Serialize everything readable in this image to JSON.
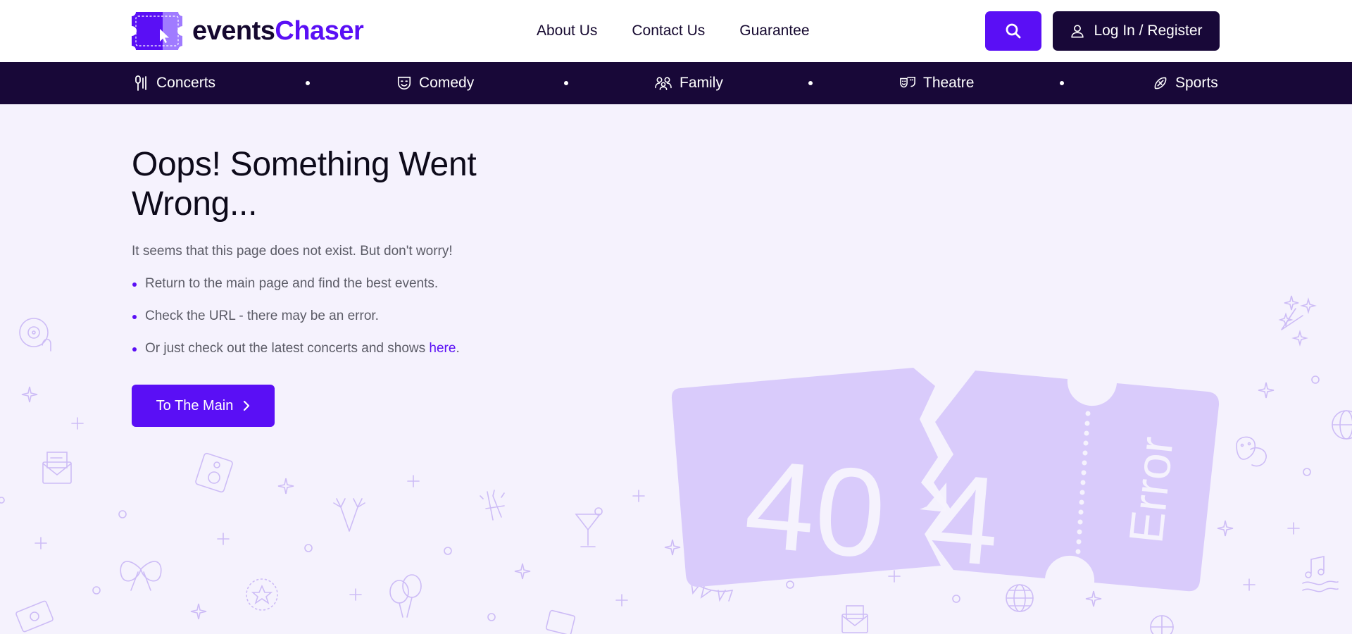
{
  "header": {
    "logo": {
      "part1": "events",
      "part2": "Chaser"
    },
    "nav": [
      "About Us",
      "Contact Us",
      "Guarantee"
    ],
    "login_label": "Log In / Register",
    "search_icon": "search-icon",
    "user_icon": "user-icon"
  },
  "categories": [
    {
      "label": "Concerts",
      "icon": "microphone-icon"
    },
    {
      "label": "Comedy",
      "icon": "comedy-mask-icon"
    },
    {
      "label": "Family",
      "icon": "family-icon"
    },
    {
      "label": "Theatre",
      "icon": "theatre-masks-icon"
    },
    {
      "label": "Sports",
      "icon": "football-icon"
    }
  ],
  "error": {
    "title": "Oops! Something Went Wrong...",
    "lead": "It seems that this page does not exist. But don't worry!",
    "items": [
      "Return to the main page and find the best events.",
      "Check the URL - there may be an error.",
      "Or just check out the latest concerts and shows "
    ],
    "link_text": "here",
    "link_suffix": ".",
    "cta_label": "To The Main",
    "ticket_code": "404",
    "ticket_label": "Error"
  },
  "colors": {
    "accent": "#5a0ff5",
    "dark": "#180838",
    "background": "#f5f2fd",
    "ticket": "#d9cbfb",
    "decor": "#c9b8f5"
  }
}
